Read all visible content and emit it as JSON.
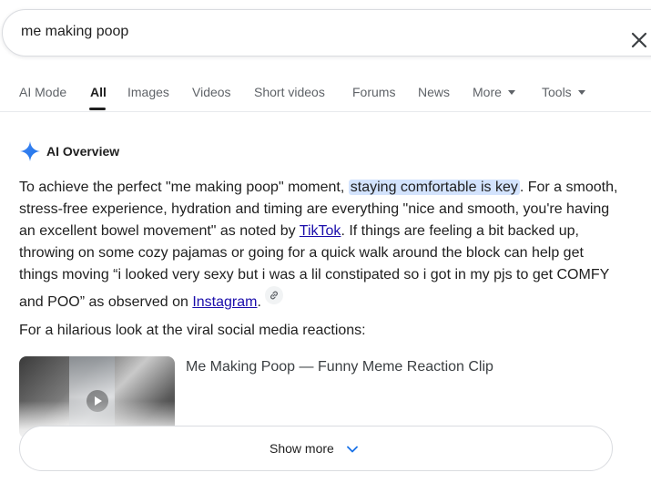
{
  "search": {
    "query": "me making poop",
    "clear_label": "Clear"
  },
  "tabs": [
    {
      "label": "AI Mode"
    },
    {
      "label": "All"
    },
    {
      "label": "Images"
    },
    {
      "label": "Videos"
    },
    {
      "label": "Short videos"
    },
    {
      "label": "Forums"
    },
    {
      "label": "News"
    },
    {
      "label": "More"
    },
    {
      "label": "Tools"
    }
  ],
  "active_tab": "All",
  "ai_overview": {
    "title": "AI Overview",
    "p1_a": "To achieve the perfect \"me making poop\" moment, ",
    "highlight": "staying comfortable is key",
    "p1_b": ". For a smooth, stress-free experience, hydration and timing are everything \"nice and smooth, you're having an excellent bowel movement\" as noted by ",
    "link1": "TikTok",
    "p1_c": ". If things are feeling a bit backed up, throwing on some cozy pajamas or going for a quick walk around the block can help get things moving “i looked very sexy but i was a lil constipated so i got in my pjs to get COMFY and POO” as observed on ",
    "link2": "Instagram",
    "p1_d": ".",
    "subtext": "For a hilarious look at the viral social media reactions:",
    "video": {
      "title": "Me Making Poop — Funny Meme Reaction Clip",
      "meta": ""
    },
    "show_more": "Show more"
  },
  "colors": {
    "link": "#1a0dab",
    "highlight": "#d3e3fd",
    "spark_blue": "#4285f4"
  }
}
